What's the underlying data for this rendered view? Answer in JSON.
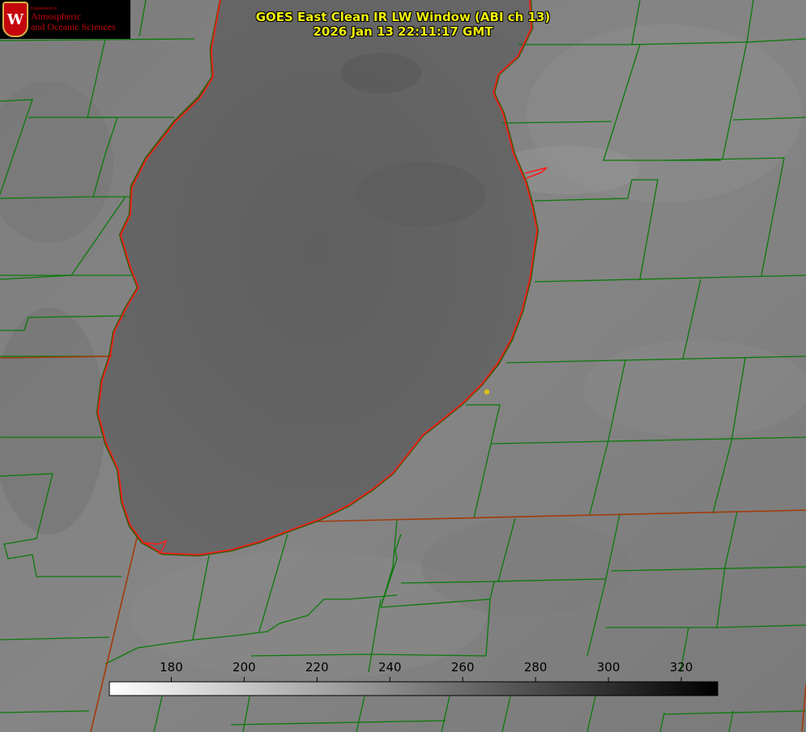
{
  "header": {
    "title_line1": "GOES East Clean IR LW Window (ABI ch 13)",
    "title_line2": "2026 Jan 13 22:11:17 GMT"
  },
  "logo": {
    "department": "Department of",
    "line1": "Atmospheric",
    "line2": "and Oceanic Sciences",
    "seal_letter": "W"
  },
  "colorbar": {
    "min": 163,
    "max": 330,
    "ticks": [
      180,
      200,
      220,
      240,
      260,
      280,
      300,
      320
    ],
    "start_color": "#ffffff",
    "end_color": "#000000"
  },
  "colors": {
    "county_lines": "#0b7a0b",
    "coastline": "#ff1a1a",
    "state_line": "#a23a0a",
    "marker": "#d8c21a",
    "title_text": "#f2f20a"
  }
}
